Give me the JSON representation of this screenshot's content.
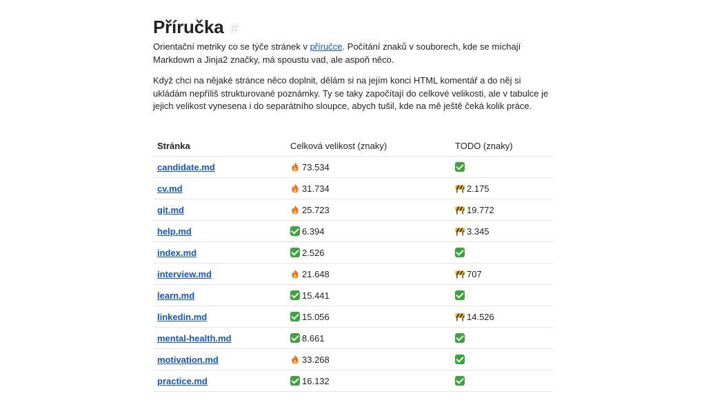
{
  "header": {
    "title": "Příručka",
    "anchor": "#"
  },
  "intro": {
    "p1_before": "Orientační metriky co se týče stránek v ",
    "p1_link": "příručce",
    "p1_after": ". Počítání znaků v souborech, kde se míchají Markdown a Jinja2 značky, má spoustu vad, ale aspoň něco.",
    "p2": "Když chci na nějaké stránce něco doplnit, dělám si na jejím konci HTML komentář a do něj si ukládám nepříliš strukturované poznámky. Ty se taky započítají do celkové velikosti, ale v tabulce je jejich velikost vynesena i do separátního sloupce, abych tušil, kde na mě ještě čeká kolik práce."
  },
  "table": {
    "headers": [
      "Stránka",
      "Celková velikost (znaky)",
      "TODO (znaky)"
    ],
    "rows": [
      {
        "page": "candidate.md",
        "size_icon": "fire-icon",
        "size": "73.534",
        "todo_icon": "check-icon",
        "todo": ""
      },
      {
        "page": "cv.md",
        "size_icon": "fire-icon",
        "size": "31.734",
        "todo_icon": "construction-icon",
        "todo": "2.175"
      },
      {
        "page": "git.md",
        "size_icon": "fire-icon",
        "size": "25.723",
        "todo_icon": "construction-icon",
        "todo": "19.772"
      },
      {
        "page": "help.md",
        "size_icon": "check-icon",
        "size": "6.394",
        "todo_icon": "construction-icon",
        "todo": "3.345"
      },
      {
        "page": "index.md",
        "size_icon": "check-icon",
        "size": "2.526",
        "todo_icon": "check-icon",
        "todo": ""
      },
      {
        "page": "interview.md",
        "size_icon": "fire-icon",
        "size": "21.648",
        "todo_icon": "construction-icon",
        "todo": "707"
      },
      {
        "page": "learn.md",
        "size_icon": "check-icon",
        "size": "15.441",
        "todo_icon": "check-icon",
        "todo": ""
      },
      {
        "page": "linkedin.md",
        "size_icon": "check-icon",
        "size": "15.056",
        "todo_icon": "construction-icon",
        "todo": "14.526"
      },
      {
        "page": "mental-health.md",
        "size_icon": "check-icon",
        "size": "8.661",
        "todo_icon": "check-icon",
        "todo": ""
      },
      {
        "page": "motivation.md",
        "size_icon": "fire-icon",
        "size": "33.268",
        "todo_icon": "check-icon",
        "todo": ""
      },
      {
        "page": "practice.md",
        "size_icon": "check-icon",
        "size": "16.132",
        "todo_icon": "check-icon",
        "todo": ""
      }
    ]
  },
  "colors": {
    "link": "#1155cc",
    "check": "#3aa53a",
    "fire": "#f36b1c",
    "construction": "#f5b800"
  }
}
